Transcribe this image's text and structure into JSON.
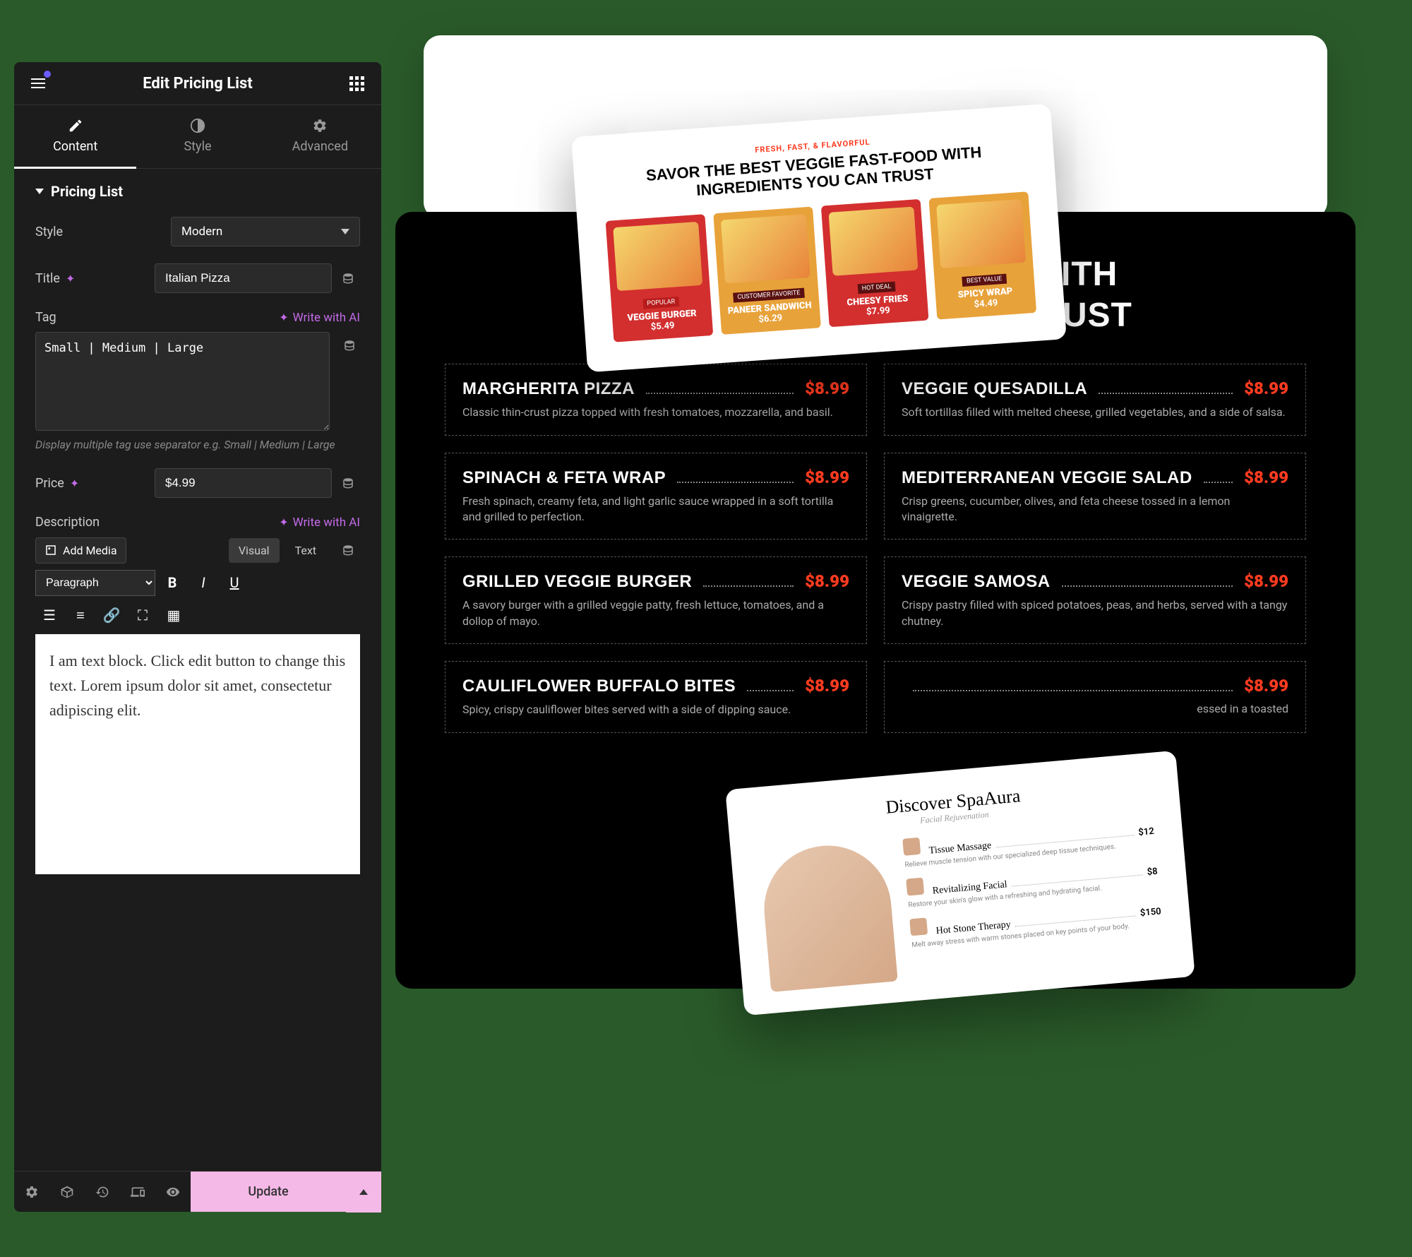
{
  "editor": {
    "title": "Edit Pricing List",
    "tabs": {
      "content": "Content",
      "style": "Style",
      "advanced": "Advanced"
    },
    "section": "Pricing List",
    "fields": {
      "style_label": "Style",
      "style_value": "Modern",
      "title_label": "Title",
      "title_value": "Italian Pizza",
      "tag_label": "Tag",
      "tag_value": "Small | Medium | Large",
      "tag_hint": "Display multiple tag use separator e.g. Small | Medium | Large",
      "price_label": "Price",
      "price_value": "$4.99",
      "description_label": "Description"
    },
    "ai_link": "Write with AI",
    "add_media": "Add Media",
    "visual_tab": "Visual",
    "text_tab": "Text",
    "paragraph": "Paragraph",
    "richtext": "I am text block. Click edit button to change this text. Lorem ipsum dolor sit amet, consectetur adipiscing elit.",
    "update": "Update"
  },
  "preview": {
    "headline_1": "WITH",
    "headline_2": "YOU CAN TRUST",
    "menu": [
      {
        "name": "MARGHERITA PIZZA",
        "price": "$8.99",
        "desc": "Classic thin-crust pizza topped with fresh tomatoes, mozzarella, and basil."
      },
      {
        "name": "VEGGIE QUESADILLA",
        "price": "$8.99",
        "desc": "Soft tortillas filled with melted cheese, grilled vegetables, and a side of salsa."
      },
      {
        "name": "SPINACH & FETA WRAP",
        "price": "$8.99",
        "desc": "Fresh spinach, creamy feta, and light garlic sauce wrapped in a soft tortilla and grilled to perfection."
      },
      {
        "name": "MEDITERRANEAN VEGGIE SALAD",
        "price": "$8.99",
        "desc": "Crisp greens, cucumber, olives, and feta cheese tossed in a lemon vinaigrette."
      },
      {
        "name": "GRILLED VEGGIE BURGER",
        "price": "$8.99",
        "desc": "A savory burger with a grilled veggie patty, fresh lettuce, tomatoes, and a dollop of mayo."
      },
      {
        "name": "VEGGIE SAMOSA",
        "price": "$8.99",
        "desc": "Crispy pastry filled with spiced potatoes, peas, and herbs, served with a tangy chutney."
      },
      {
        "name": "CAULIFLOWER BUFFALO BITES",
        "price": "$8.99",
        "desc": "Spicy, crispy cauliflower bites served with a side of dipping sauce."
      },
      {
        "name": "",
        "price": "$8.99",
        "desc": "essed in a toasted"
      }
    ]
  },
  "food_card": {
    "tag": "FRESH, FAST, & FLAVORFUL",
    "title": "SAVOR THE BEST VEGGIE FAST-FOOD WITH INGREDIENTS YOU CAN TRUST",
    "items": [
      {
        "badge": "POPULAR",
        "name": "VEGGIE BURGER",
        "price": "$5.49"
      },
      {
        "badge": "CUSTOMER FAVORITE",
        "name": "PANEER SANDWICH",
        "price": "$6.29"
      },
      {
        "badge": "HOT DEAL",
        "name": "CHEESY FRIES",
        "price": "$7.99"
      },
      {
        "badge": "BEST VALUE",
        "name": "SPICY WRAP",
        "price": "$4.49"
      }
    ]
  },
  "spa_card": {
    "title": "Discover SpaAura",
    "sub": "Facial Rejuvenation",
    "items": [
      {
        "name": "Tissue Massage",
        "price": "$12",
        "desc": "Relieve muscle tension with our specialized deep tissue techniques."
      },
      {
        "name": "Revitalizing Facial",
        "price": "$8",
        "desc": "Restore your skin's glow with a refreshing and hydrating facial."
      },
      {
        "name": "Hot Stone Therapy",
        "price": "$150",
        "desc": "Melt away stress with warm stones placed on key points of your body."
      }
    ]
  }
}
